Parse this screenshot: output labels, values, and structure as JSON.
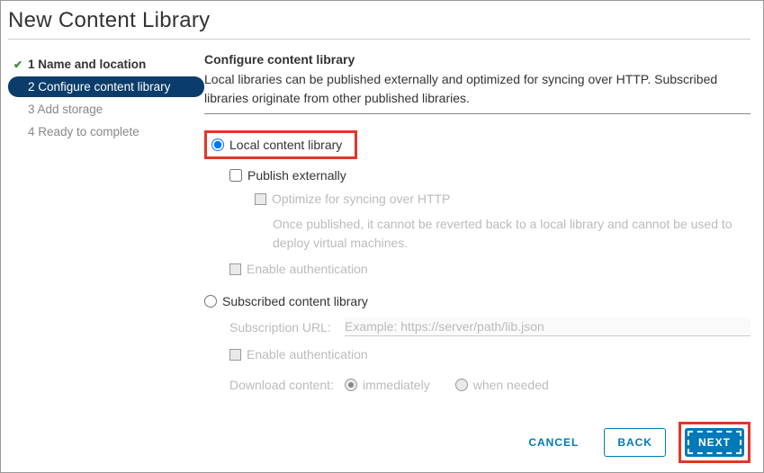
{
  "header": {
    "title": "New Content Library"
  },
  "wizard": {
    "steps": [
      {
        "label": "1 Name and location"
      },
      {
        "label": "2 Configure content library"
      },
      {
        "label": "3 Add storage"
      },
      {
        "label": "4 Ready to complete"
      }
    ]
  },
  "main": {
    "title": "Configure content library",
    "description": "Local libraries can be published externally and optimized for syncing over HTTP. Subscribed libraries originate from other published libraries.",
    "local_label": "Local content library",
    "publish_externally_label": "Publish externally",
    "optimize_label": "Optimize for syncing over HTTP",
    "optimize_note": "Once published, it cannot be reverted back to a local library and cannot be used to deploy virtual machines.",
    "enable_auth_label": "Enable authentication",
    "subscribed_label": "Subscribed content library",
    "subscription_url_label": "Subscription URL:",
    "subscription_url_placeholder": "Example: https://server/path/lib.json",
    "enable_auth_sub_label": "Enable authentication",
    "download_label": "Download content:",
    "download_immediately": "immediately",
    "download_when_needed": "when needed"
  },
  "footer": {
    "cancel": "CANCEL",
    "back": "BACK",
    "next": "NEXT"
  }
}
